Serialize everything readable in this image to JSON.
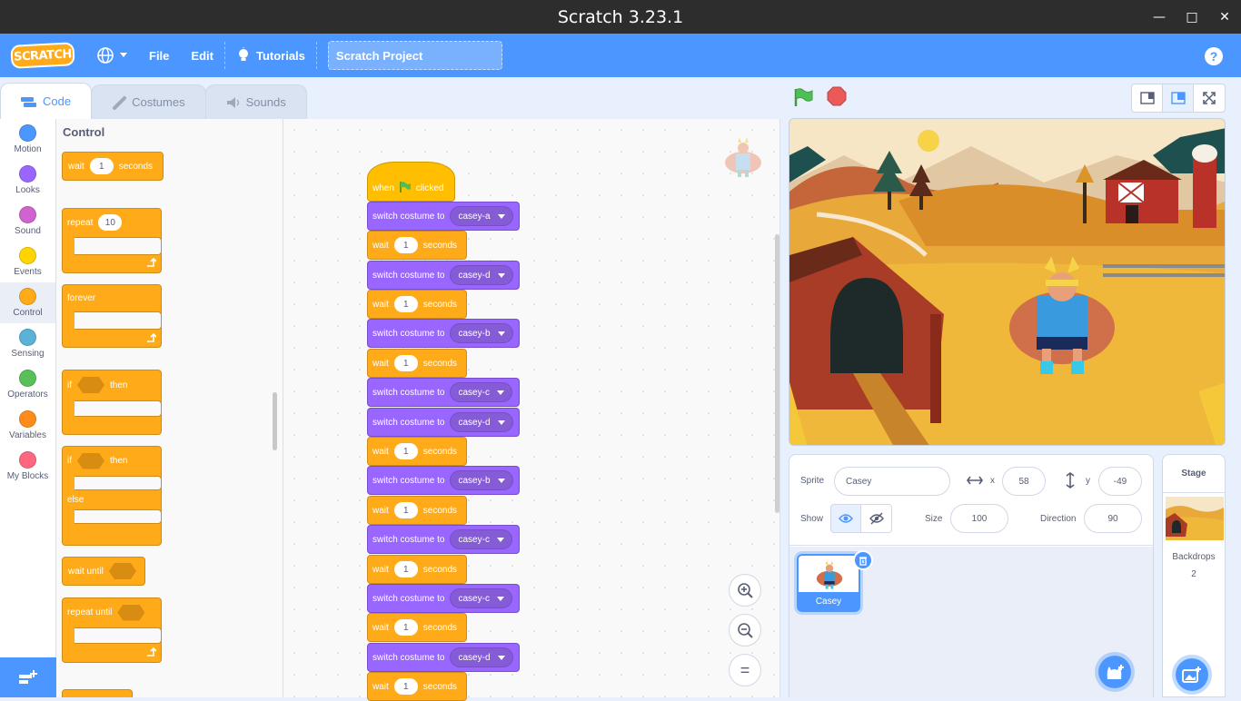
{
  "window": {
    "title": "Scratch 3.23.1",
    "min": "—",
    "max": "□",
    "close": "✕"
  },
  "menubar": {
    "logo": "SCRATCH",
    "file": "File",
    "edit": "Edit",
    "tutorials": "Tutorials",
    "project_title": "Scratch Project",
    "help": "?"
  },
  "tabs": [
    {
      "label": "Code"
    },
    {
      "label": "Costumes"
    },
    {
      "label": "Sounds"
    }
  ],
  "categories": [
    {
      "label": "Motion",
      "color": "#4c97ff"
    },
    {
      "label": "Looks",
      "color": "#9966ff"
    },
    {
      "label": "Sound",
      "color": "#cf63cf"
    },
    {
      "label": "Events",
      "color": "#ffd500"
    },
    {
      "label": "Control",
      "color": "#ffab19"
    },
    {
      "label": "Sensing",
      "color": "#5cb1d6"
    },
    {
      "label": "Operators",
      "color": "#59c059"
    },
    {
      "label": "Variables",
      "color": "#ff8c1a"
    },
    {
      "label": "My Blocks",
      "color": "#ff6680"
    }
  ],
  "palette": {
    "title": "Control",
    "wait": {
      "label": "wait",
      "value": "1",
      "unit": "seconds"
    },
    "repeat": {
      "label": "repeat",
      "value": "10"
    },
    "forever": "forever",
    "if_then": {
      "if": "if",
      "then": "then"
    },
    "if_else": {
      "if": "if",
      "then": "then",
      "else": "else"
    },
    "wait_until": "wait until",
    "repeat_until": "repeat until"
  },
  "script": {
    "hat": {
      "when": "when",
      "clicked": "clicked"
    },
    "switch_label": "switch costume to",
    "wait_label": "wait",
    "wait_value": "1",
    "wait_unit": "seconds",
    "costumes": [
      "casey-a",
      "casey-d",
      "casey-b",
      "casey-c",
      "casey-d",
      "casey-b",
      "casey-c",
      "casey-c",
      "casey-d"
    ]
  },
  "zoom": {
    "in": "+",
    "out": "−",
    "reset": "="
  },
  "sprite_info": {
    "sprite_label": "Sprite",
    "sprite_name": "Casey",
    "x_label": "x",
    "x_value": "58",
    "y_label": "y",
    "y_value": "-49",
    "show_label": "Show",
    "size_label": "Size",
    "size_value": "100",
    "direction_label": "Direction",
    "direction_value": "90"
  },
  "sprites": [
    {
      "name": "Casey"
    }
  ],
  "stage_panel": {
    "title": "Stage",
    "backdrops_label": "Backdrops",
    "backdrops_count": "2"
  },
  "colors": {
    "accent": "#4c97ff",
    "control": "#ffab19",
    "looks": "#9966ff",
    "events": "#ffbf00"
  }
}
